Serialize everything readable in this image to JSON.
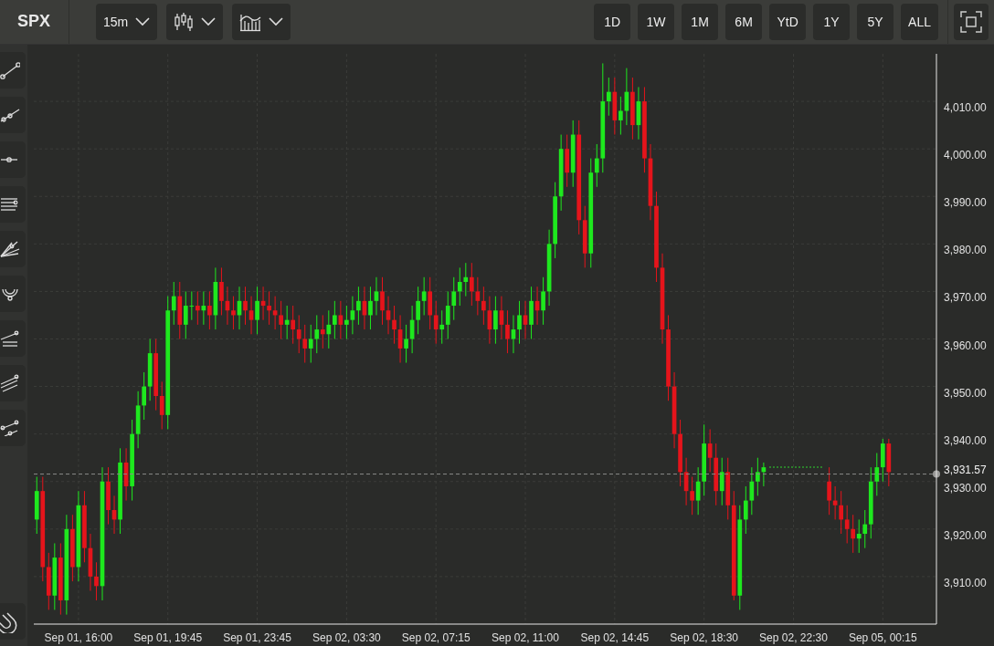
{
  "symbol": "SPX",
  "toolbar": {
    "interval": "15m",
    "ranges": [
      "1D",
      "1W",
      "1M",
      "6M",
      "YtD",
      "1Y",
      "5Y",
      "ALL"
    ]
  },
  "chart": {
    "chart_data": {
      "type": "candlestick",
      "grid": true,
      "ylim": [
        3900,
        4020
      ],
      "categories": [
        null,
        null,
        null,
        null,
        null,
        null,
        null,
        "Sep 01, 16:00",
        null,
        null,
        null,
        null,
        null,
        null,
        null,
        null,
        null,
        null,
        null,
        null,
        null,
        null,
        "Sep 01, 19:45",
        null,
        null,
        null,
        null,
        null,
        null,
        null,
        null,
        null,
        null,
        null,
        null,
        null,
        null,
        "Sep 01, 23:45",
        null,
        null,
        null,
        null,
        null,
        null,
        null,
        null,
        null,
        null,
        null,
        null,
        null,
        null,
        "Sep 02, 03:30",
        null,
        null,
        null,
        null,
        null,
        null,
        null,
        null,
        null,
        null,
        null,
        null,
        null,
        null,
        "Sep 02, 07:15",
        null,
        null,
        null,
        null,
        null,
        null,
        null,
        null,
        null,
        null,
        null,
        null,
        null,
        null,
        "Sep 02, 11:00",
        null,
        null,
        null,
        null,
        null,
        null,
        null,
        null,
        null,
        null,
        null,
        null,
        null,
        null,
        "Sep 02, 14:45",
        null,
        null,
        null,
        null,
        null,
        null,
        null,
        null,
        null,
        null,
        null,
        null,
        null,
        null,
        "Sep 02, 18:30",
        null,
        null,
        null,
        null,
        null,
        null,
        null,
        null,
        null,
        null,
        null,
        null,
        null,
        null,
        "Sep 02, 22:30",
        null,
        null,
        null,
        null,
        null,
        null,
        null,
        null,
        null,
        null,
        null,
        null,
        null,
        null,
        "Sep 05, 00:15",
        null
      ],
      "yticks": [
        {
          "value": 3910,
          "label": "3,910.00"
        },
        {
          "value": 3920,
          "label": "3,920.00"
        },
        {
          "value": 3930,
          "label": "3,930.00"
        },
        {
          "value": 3940,
          "label": "3,940.00"
        },
        {
          "value": 3950,
          "label": "3,950.00"
        },
        {
          "value": 3960,
          "label": "3,960.00"
        },
        {
          "value": 3970,
          "label": "3,970.00"
        },
        {
          "value": 3980,
          "label": "3,980.00"
        },
        {
          "value": 3990,
          "label": "3,990.00"
        },
        {
          "value": 4000,
          "label": "4,000.00"
        },
        {
          "value": 4010,
          "label": "4,010.00"
        }
      ],
      "ohlc": [
        [
          3922,
          3931,
          3919,
          3928
        ],
        [
          3928,
          3931,
          3909,
          3912
        ],
        [
          3912,
          3915,
          3903,
          3906
        ],
        [
          3906,
          3917,
          3903,
          3914
        ],
        [
          3914,
          3917,
          3902,
          3905
        ],
        [
          3905,
          3923,
          3902,
          3920
        ],
        [
          3920,
          3923,
          3909,
          3912
        ],
        [
          3912,
          3928,
          3909,
          3925
        ],
        [
          3925,
          3928,
          3913,
          3916
        ],
        [
          3916,
          3919,
          3907,
          3910
        ],
        [
          3910,
          3913,
          3905,
          3908
        ],
        [
          3908,
          3933,
          3905,
          3930
        ],
        [
          3930,
          3933,
          3921,
          3924
        ],
        [
          3924,
          3927,
          3919,
          3922
        ],
        [
          3922,
          3937,
          3919,
          3934
        ],
        [
          3934,
          3937,
          3926,
          3929
        ],
        [
          3929,
          3943,
          3926,
          3940
        ],
        [
          3940,
          3949,
          3937,
          3946
        ],
        [
          3946,
          3953,
          3943,
          3950
        ],
        [
          3950,
          3960,
          3947,
          3957
        ],
        [
          3957,
          3960,
          3945,
          3948
        ],
        [
          3948,
          3951,
          3941,
          3944
        ],
        [
          3944,
          3969,
          3941,
          3966
        ],
        [
          3966,
          3972,
          3963,
          3969
        ],
        [
          3969,
          3972,
          3960,
          3963
        ],
        [
          3963,
          3970,
          3960,
          3967
        ],
        [
          3967,
          3970,
          3964,
          3967
        ],
        [
          3967,
          3970,
          3963,
          3966
        ],
        [
          3966,
          3970,
          3963,
          3967
        ],
        [
          3967,
          3970,
          3962,
          3965
        ],
        [
          3965,
          3975,
          3962,
          3972
        ],
        [
          3972,
          3975,
          3965,
          3968
        ],
        [
          3968,
          3971,
          3963,
          3966
        ],
        [
          3966,
          3969,
          3962,
          3965
        ],
        [
          3965,
          3971,
          3962,
          3968
        ],
        [
          3968,
          3971,
          3963,
          3966
        ],
        [
          3966,
          3969,
          3961,
          3964
        ],
        [
          3964,
          3971,
          3961,
          3968
        ],
        [
          3968,
          3971,
          3964,
          3967
        ],
        [
          3967,
          3970,
          3963,
          3966
        ],
        [
          3966,
          3969,
          3962,
          3965
        ],
        [
          3965,
          3968,
          3960,
          3963
        ],
        [
          3963,
          3967,
          3960,
          3964
        ],
        [
          3964,
          3967,
          3959,
          3962
        ],
        [
          3962,
          3965,
          3957,
          3960
        ],
        [
          3960,
          3963,
          3955,
          3958
        ],
        [
          3958,
          3963,
          3955,
          3960
        ],
        [
          3960,
          3965,
          3957,
          3962
        ],
        [
          3962,
          3965,
          3958,
          3961
        ],
        [
          3961,
          3966,
          3958,
          3963
        ],
        [
          3963,
          3968,
          3960,
          3965
        ],
        [
          3965,
          3968,
          3960,
          3963
        ],
        [
          3963,
          3967,
          3960,
          3964
        ],
        [
          3964,
          3969,
          3961,
          3966
        ],
        [
          3966,
          3971,
          3963,
          3968
        ],
        [
          3968,
          3971,
          3962,
          3965
        ],
        [
          3965,
          3971,
          3962,
          3968
        ],
        [
          3968,
          3973,
          3965,
          3970
        ],
        [
          3970,
          3973,
          3963,
          3966
        ],
        [
          3966,
          3969,
          3961,
          3964
        ],
        [
          3964,
          3967,
          3959,
          3962
        ],
        [
          3962,
          3965,
          3955,
          3958
        ],
        [
          3958,
          3963,
          3955,
          3960
        ],
        [
          3960,
          3967,
          3957,
          3964
        ],
        [
          3964,
          3971,
          3961,
          3968
        ],
        [
          3968,
          3973,
          3965,
          3970
        ],
        [
          3970,
          3973,
          3962,
          3965
        ],
        [
          3965,
          3968,
          3959,
          3962
        ],
        [
          3962,
          3966,
          3959,
          3963
        ],
        [
          3963,
          3970,
          3960,
          3967
        ],
        [
          3967,
          3973,
          3964,
          3970
        ],
        [
          3970,
          3975,
          3967,
          3972
        ],
        [
          3972,
          3976,
          3969,
          3973
        ],
        [
          3973,
          3976,
          3967,
          3970
        ],
        [
          3970,
          3973,
          3965,
          3968
        ],
        [
          3968,
          3971,
          3963,
          3966
        ],
        [
          3966,
          3969,
          3959,
          3962
        ],
        [
          3962,
          3969,
          3959,
          3966
        ],
        [
          3966,
          3969,
          3960,
          3963
        ],
        [
          3963,
          3966,
          3957,
          3960
        ],
        [
          3960,
          3965,
          3957,
          3962
        ],
        [
          3962,
          3968,
          3959,
          3965
        ],
        [
          3965,
          3968,
          3960,
          3963
        ],
        [
          3963,
          3971,
          3960,
          3968
        ],
        [
          3968,
          3971,
          3963,
          3966
        ],
        [
          3966,
          3973,
          3963,
          3970
        ],
        [
          3970,
          3983,
          3967,
          3980
        ],
        [
          3980,
          3993,
          3977,
          3990
        ],
        [
          3990,
          4003,
          3987,
          4000
        ],
        [
          4000,
          4003,
          3992,
          3995
        ],
        [
          3995,
          4006,
          3992,
          4003
        ],
        [
          4003,
          4006,
          3982,
          3985
        ],
        [
          3985,
          3988,
          3975,
          3978
        ],
        [
          3978,
          3998,
          3975,
          3995
        ],
        [
          3995,
          4001,
          3992,
          3998
        ],
        [
          3998,
          4018,
          3995,
          4010
        ],
        [
          4010,
          4015,
          4007,
          4012
        ],
        [
          4012,
          4015,
          4003,
          4006
        ],
        [
          4006,
          4011,
          4003,
          4008
        ],
        [
          4008,
          4017,
          4005,
          4012
        ],
        [
          4012,
          4015,
          4002,
          4005
        ],
        [
          4005,
          4013,
          4002,
          4010
        ],
        [
          4010,
          4013,
          3995,
          3998
        ],
        [
          3998,
          4001,
          3985,
          3988
        ],
        [
          3988,
          3991,
          3972,
          3975
        ],
        [
          3975,
          3978,
          3959,
          3962
        ],
        [
          3962,
          3965,
          3947,
          3950
        ],
        [
          3950,
          3953,
          3937,
          3940
        ],
        [
          3940,
          3943,
          3929,
          3932
        ],
        [
          3932,
          3935,
          3925,
          3928
        ],
        [
          3928,
          3931,
          3923,
          3926
        ],
        [
          3926,
          3933,
          3923,
          3930
        ],
        [
          3930,
          3942,
          3927,
          3938
        ],
        [
          3938,
          3941,
          3932,
          3935
        ],
        [
          3935,
          3938,
          3925,
          3928
        ],
        [
          3928,
          3935,
          3925,
          3932
        ],
        [
          3932,
          3935,
          3922,
          3925
        ],
        [
          3925,
          3928,
          3905,
          3906
        ],
        [
          3906,
          3925,
          3903,
          3922
        ],
        [
          3922,
          3929,
          3919,
          3926
        ],
        [
          3926,
          3933,
          3923,
          3930
        ],
        [
          3930,
          3935,
          3927,
          3932
        ],
        [
          3932,
          3934,
          3929,
          3933
        ],
        null,
        null,
        null,
        null,
        null,
        null,
        null,
        null,
        null,
        null,
        [
          3930,
          3933,
          3923,
          3926
        ],
        [
          3926,
          3929,
          3922,
          3925
        ],
        [
          3925,
          3928,
          3919,
          3922
        ],
        [
          3922,
          3925,
          3917,
          3920
        ],
        [
          3920,
          3923,
          3915,
          3918
        ],
        [
          3918,
          3922,
          3915,
          3919
        ],
        [
          3919,
          3924,
          3916,
          3921
        ],
        [
          3921,
          3933,
          3918,
          3930
        ],
        [
          3930,
          3936,
          3927,
          3933
        ],
        [
          3933,
          3939,
          3930,
          3938
        ],
        [
          3938,
          3939,
          3929,
          3932
        ]
      ],
      "ref_lines": [
        {
          "axis": "y",
          "value": 3931.57,
          "label": "3,931.57"
        }
      ]
    }
  }
}
